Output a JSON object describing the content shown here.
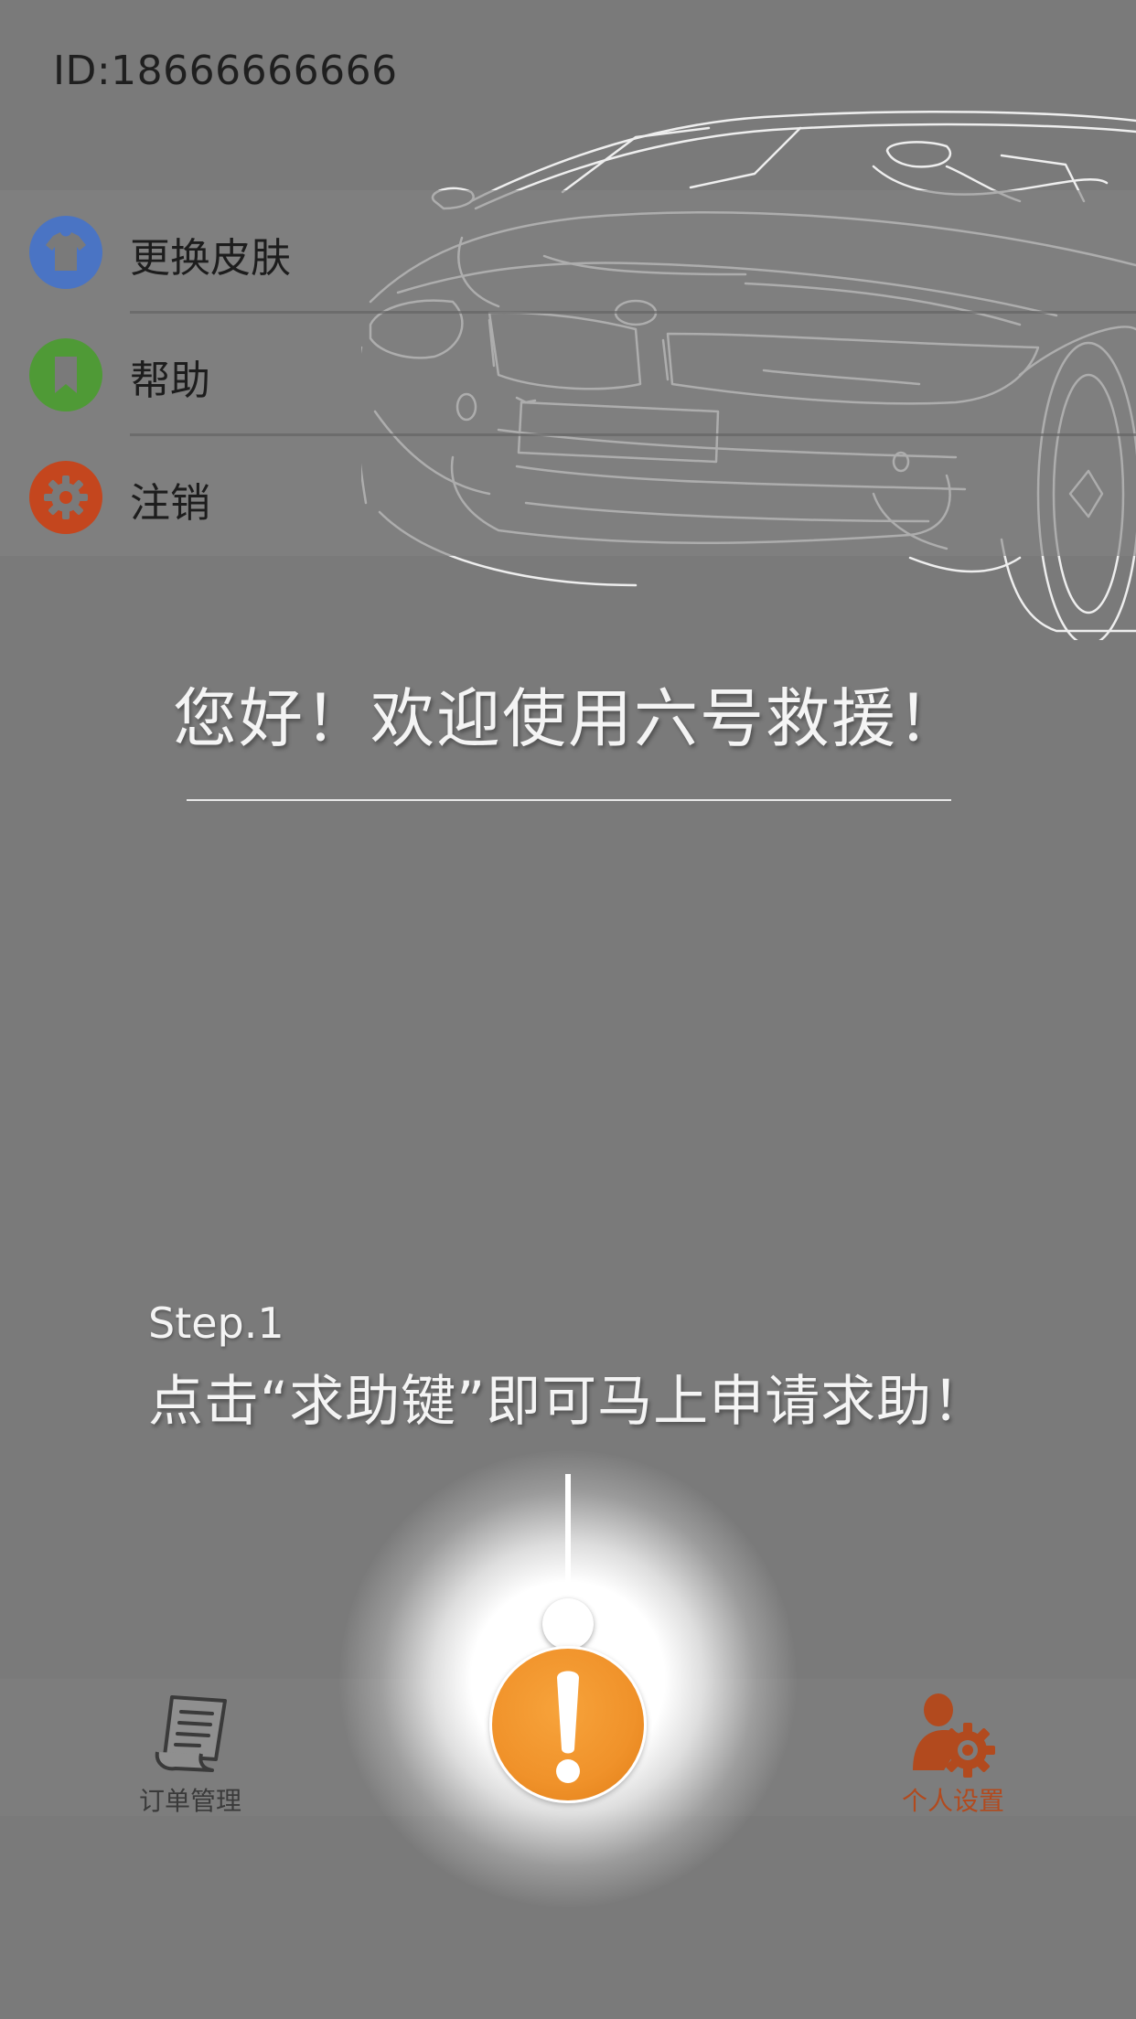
{
  "header": {
    "user_id": "ID:18666666666"
  },
  "illustration": {
    "name": "car-outline-icon"
  },
  "menu": {
    "items": [
      {
        "label": "更换皮肤",
        "icon": "tshirt-icon",
        "color": "#4a74c4"
      },
      {
        "label": "帮助",
        "icon": "bookmark-icon",
        "color": "#4f9a36"
      },
      {
        "label": "注销",
        "icon": "gear-icon",
        "color": "#c4461e"
      }
    ]
  },
  "main": {
    "welcome": "您好！欢迎使用六号救援！"
  },
  "guide": {
    "step_label": "Step.1",
    "step_text": "点击“求助键”即可马上申请求助！"
  },
  "bottom_nav": {
    "orders_label": "订单管理",
    "orders_icon": "document-icon",
    "settings_label": "个人设置",
    "settings_icon": "user-gear-icon",
    "sos_icon": "exclamation-icon"
  },
  "colors": {
    "background": "#7a7a7a",
    "sos_orange": "#f0922a",
    "settings_accent": "#b24a1e"
  }
}
